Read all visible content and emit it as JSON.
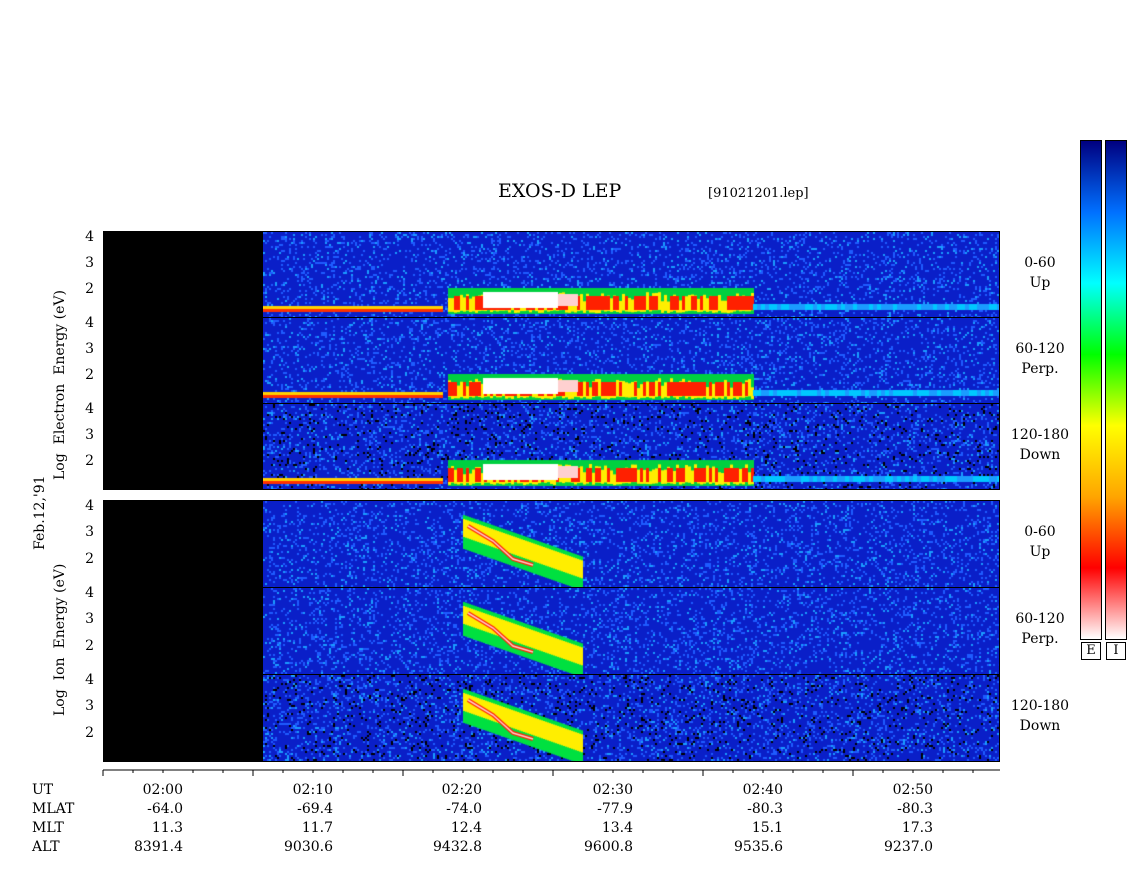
{
  "title": "EXOS-D LEP",
  "file_label": "[91021201.lep]",
  "date_label": "Feb.12,'91",
  "colorbar": {
    "letters": [
      "E",
      "I"
    ],
    "colors": [
      "#ffffff",
      "#ff0000",
      "#ffa500",
      "#ffff00",
      "#00ff00",
      "#00ffff",
      "#0070ff",
      "#000080"
    ]
  },
  "chart_data": [
    {
      "type": "heatmap",
      "species": "Electron",
      "ylabel_parts": [
        "Log",
        "Electron",
        "Energy",
        "(eV)"
      ],
      "panels": [
        {
          "angle": "0-60",
          "direction": "Up",
          "yticks": [
            "4",
            "3",
            "2"
          ]
        },
        {
          "angle": "60-120",
          "direction": "Perp.",
          "yticks": [
            "4",
            "3",
            "2"
          ]
        },
        {
          "angle": "120-180",
          "direction": "Down",
          "yticks": [
            "4",
            "3",
            "2"
          ]
        }
      ]
    },
    {
      "type": "heatmap",
      "species": "Ion",
      "ylabel_parts": [
        "Log",
        "Ion",
        "Energy",
        "(eV)"
      ],
      "panels": [
        {
          "angle": "0-60",
          "direction": "Up",
          "yticks": [
            "4",
            "3",
            "2"
          ]
        },
        {
          "angle": "60-120",
          "direction": "Perp.",
          "yticks": [
            "4",
            "3",
            "2"
          ]
        },
        {
          "angle": "120-180",
          "direction": "Down",
          "yticks": [
            "4",
            "3",
            "2"
          ]
        }
      ]
    }
  ],
  "time_axis": {
    "row_labels": [
      "UT",
      "MLAT",
      "MLT",
      "ALT"
    ],
    "columns": [
      {
        "UT": "02:00",
        "MLAT": "-64.0",
        "MLT": "11.3",
        "ALT": "8391.4"
      },
      {
        "UT": "02:10",
        "MLAT": "-69.4",
        "MLT": "11.7",
        "ALT": "9030.6"
      },
      {
        "UT": "02:20",
        "MLAT": "-74.0",
        "MLT": "12.4",
        "ALT": "9432.8"
      },
      {
        "UT": "02:30",
        "MLAT": "-77.9",
        "MLT": "13.4",
        "ALT": "9600.8"
      },
      {
        "UT": "02:40",
        "MLAT": "-80.3",
        "MLT": "15.1",
        "ALT": "9535.6"
      },
      {
        "UT": "02:50",
        "MLAT": "-80.3",
        "MLT": "17.3",
        "ALT": "9237.0"
      }
    ]
  }
}
